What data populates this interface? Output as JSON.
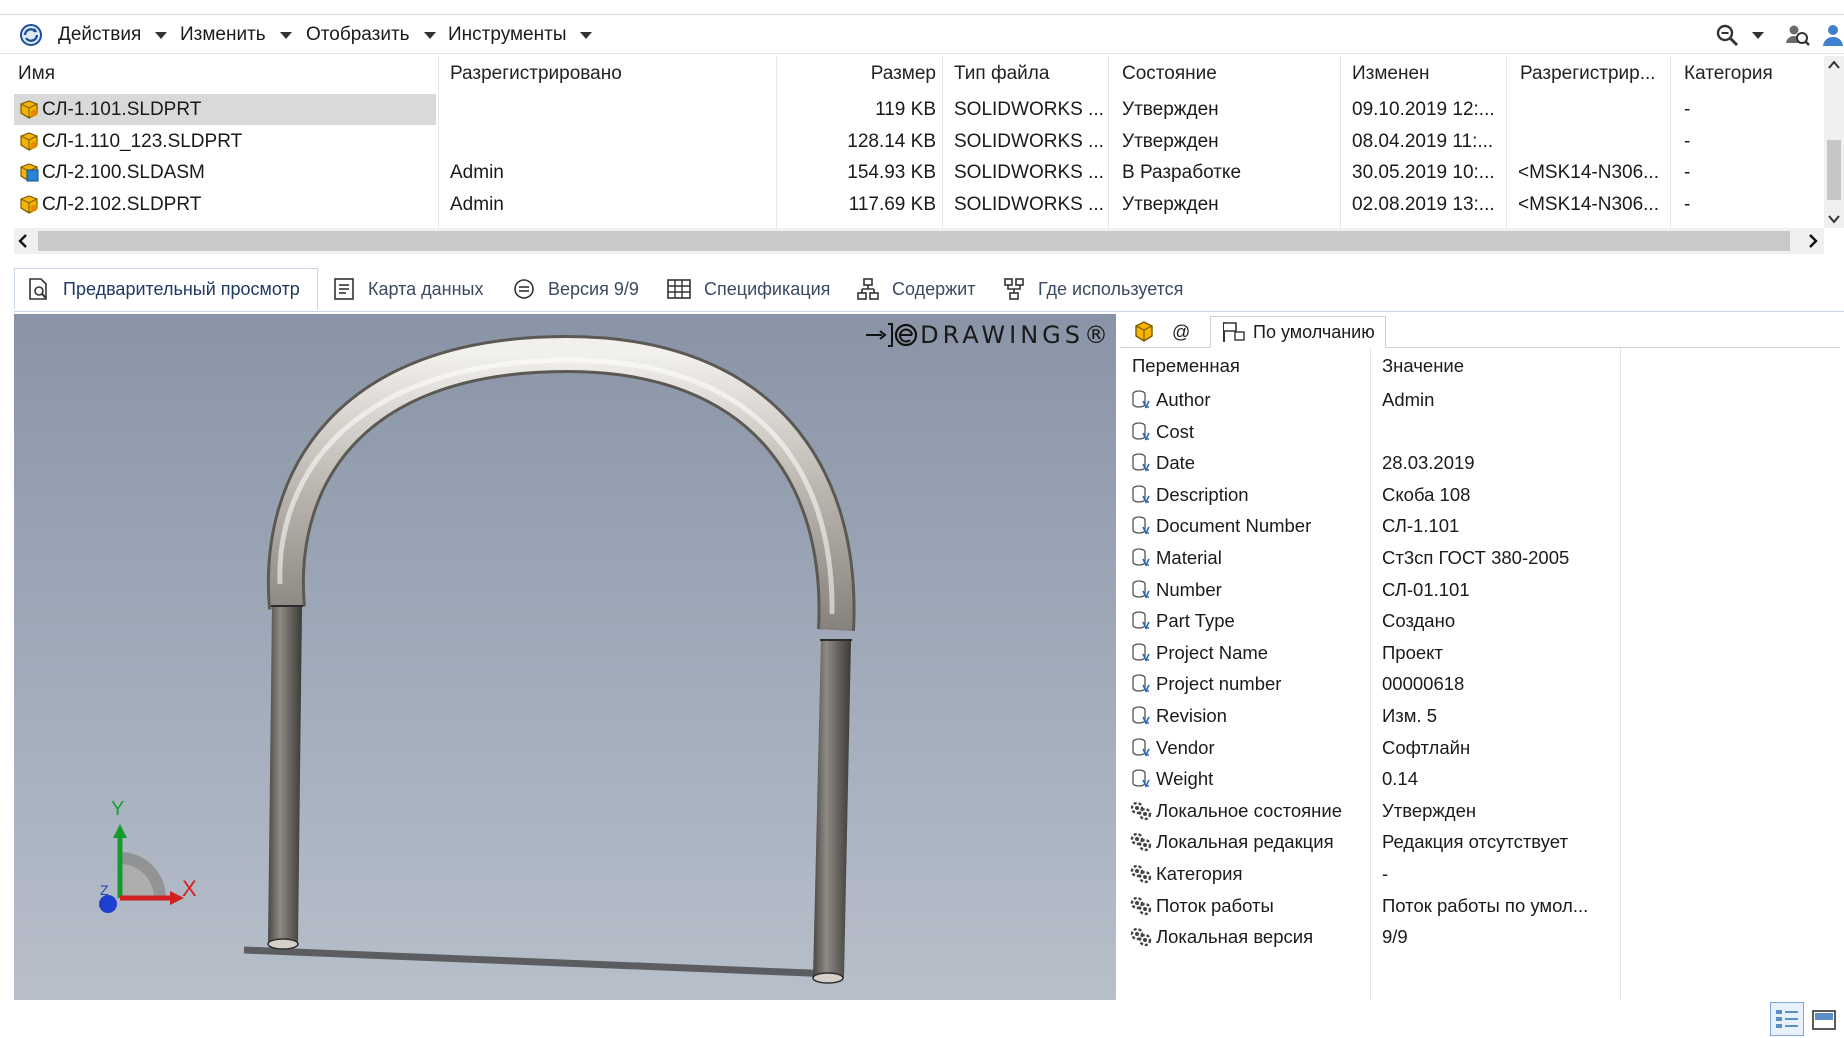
{
  "toolbar": {
    "menus": [
      "Действия",
      "Изменить",
      "Отобразить",
      "Инструменты"
    ]
  },
  "file_list": {
    "columns": [
      "Имя",
      "Разрегистрировано",
      "Размер",
      "Тип файла",
      "Состояние",
      "Изменен",
      "Разрегистрир...",
      "Категория"
    ],
    "rows": [
      {
        "name": "СЛ-1.101.SLDPRT",
        "checked_out_by": "",
        "size": "119 KB",
        "type": "SOLIDWORKS ...",
        "state": "Утвержден",
        "modified": "09.10.2019 12:...",
        "checked_out_in": "",
        "category": "-",
        "selected": true,
        "kind": "part"
      },
      {
        "name": "СЛ-1.110_123.SLDPRT",
        "checked_out_by": "",
        "size": "128.14 KB",
        "type": "SOLIDWORKS ...",
        "state": "Утвержден",
        "modified": "08.04.2019 11:...",
        "checked_out_in": "",
        "category": "-",
        "selected": false,
        "kind": "part"
      },
      {
        "name": "СЛ-2.100.SLDASM",
        "checked_out_by": "Admin",
        "size": "154.93 KB",
        "type": "SOLIDWORKS ...",
        "state": "В Разработке",
        "modified": "30.05.2019 10:...",
        "checked_out_in": "<MSK14-N306...",
        "category": "-",
        "selected": false,
        "kind": "assembly"
      },
      {
        "name": "СЛ-2.102.SLDPRT",
        "checked_out_by": "Admin",
        "size": "117.69 KB",
        "type": "SOLIDWORKS ...",
        "state": "Утвержден",
        "modified": "02.08.2019 13:...",
        "checked_out_in": "<MSK14-N306...",
        "category": "-",
        "selected": false,
        "kind": "part"
      }
    ]
  },
  "tabs": [
    {
      "label": "Предварительный просмотр",
      "icon": "preview-icon",
      "active": true
    },
    {
      "label": "Карта данных",
      "icon": "datacard-icon",
      "active": false
    },
    {
      "label": "Версия 9/9",
      "icon": "version-icon",
      "active": false
    },
    {
      "label": "Спецификация",
      "icon": "bom-icon",
      "active": false
    },
    {
      "label": "Содержит",
      "icon": "contains-icon",
      "active": false
    },
    {
      "label": "Где используется",
      "icon": "where-used-icon",
      "active": false
    }
  ],
  "preview": {
    "logo_text": "DRAWINGS®",
    "axes": {
      "x": "X",
      "y": "Y",
      "z": "Z"
    }
  },
  "properties": {
    "tab_at": "@",
    "config_label": "По умолчанию",
    "header_var": "Переменная",
    "header_val": "Значение",
    "rows": [
      {
        "name": "Author",
        "value": "Admin",
        "kind": "variable"
      },
      {
        "name": "Cost",
        "value": "",
        "kind": "variable"
      },
      {
        "name": "Date",
        "value": "28.03.2019",
        "kind": "variable"
      },
      {
        "name": "Description",
        "value": "Скоба 108",
        "kind": "variable"
      },
      {
        "name": "Document Number",
        "value": "СЛ-1.101",
        "kind": "variable"
      },
      {
        "name": "Material",
        "value": "Ст3сп ГОСТ 380-2005",
        "kind": "variable"
      },
      {
        "name": "Number",
        "value": "СЛ-01.101",
        "kind": "variable"
      },
      {
        "name": "Part Type",
        "value": "Создано",
        "kind": "variable"
      },
      {
        "name": "Project Name",
        "value": "Проект",
        "kind": "variable"
      },
      {
        "name": "Project number",
        "value": "00000618",
        "kind": "variable"
      },
      {
        "name": "Revision",
        "value": "Изм. 5",
        "kind": "variable"
      },
      {
        "name": "Vendor",
        "value": "Софтлайн",
        "kind": "variable"
      },
      {
        "name": "Weight",
        "value": "0.14",
        "kind": "variable"
      },
      {
        "name": "Локальное состояние",
        "value": "Утвержден",
        "kind": "system"
      },
      {
        "name": "Локальная редакция",
        "value": "Редакция отсутствует",
        "kind": "system"
      },
      {
        "name": "Категория",
        "value": "-",
        "kind": "system"
      },
      {
        "name": "Поток работы",
        "value": "Поток работы по умол...",
        "kind": "system"
      },
      {
        "name": "Локальная версия",
        "value": "9/9",
        "kind": "system"
      }
    ]
  }
}
